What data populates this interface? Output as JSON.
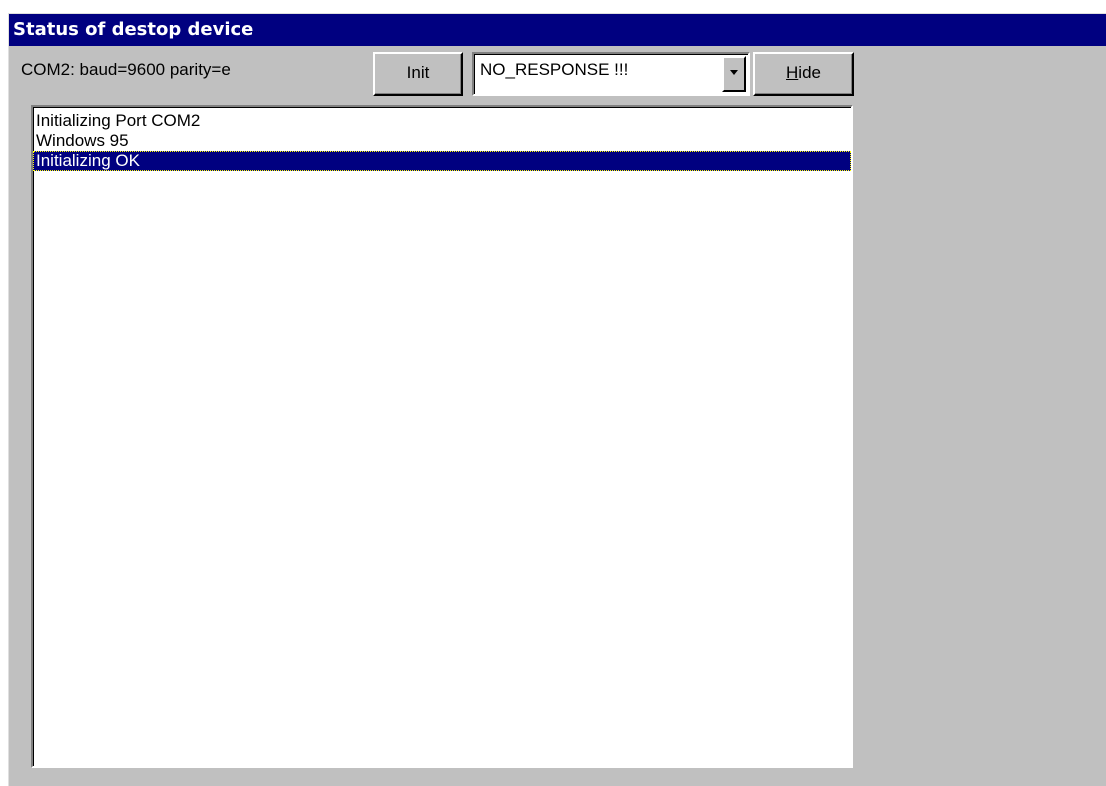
{
  "window": {
    "title": "Status of destop device"
  },
  "toolbar": {
    "port_label": "COM2: baud=9600 parity=e",
    "init_label": "Init",
    "hide_label": "Hide"
  },
  "combo": {
    "selected_value": "NO_RESPONSE !!!",
    "arrow_icon": "chevron-down-icon"
  },
  "log": {
    "items": [
      "Initializing Port COM2",
      "Windows 95",
      "Initializing OK"
    ],
    "selected_index": 2
  },
  "colors": {
    "titlebar": "#000080",
    "face": "#c0c0c0",
    "selection": "#000080"
  }
}
